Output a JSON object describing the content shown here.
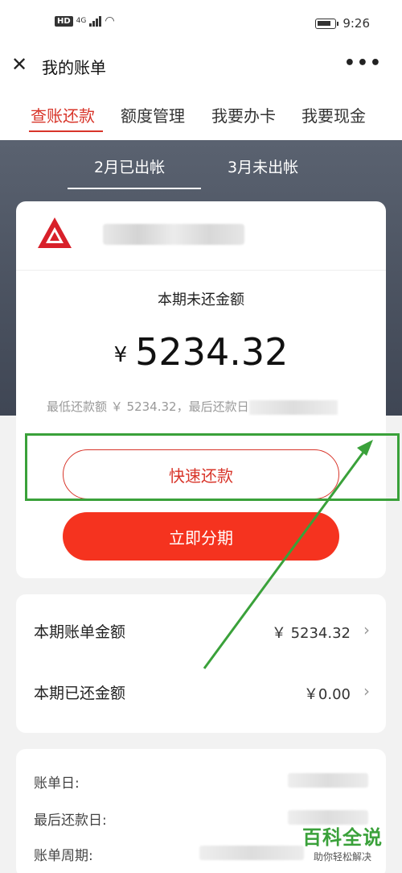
{
  "status_bar": {
    "hd": "HD",
    "network": "4G",
    "time": "9:26"
  },
  "title_bar": {
    "title": "我的账单"
  },
  "tabs": [
    {
      "label": "查账还款",
      "active": true
    },
    {
      "label": "额度管理",
      "active": false
    },
    {
      "label": "我要办卡",
      "active": false
    },
    {
      "label": "我要现金",
      "active": false
    }
  ],
  "month_tabs": [
    {
      "label": "2月已出帐",
      "active": true
    },
    {
      "label": "3月未出帐",
      "active": false
    }
  ],
  "bill": {
    "unpaid_label": "本期未还金额",
    "currency": "¥",
    "unpaid_amount": "5234.32",
    "min_pay_text": "最低还款额 ￥ 5234.32，最后还款日",
    "quick_pay_label": "快速还款",
    "installment_label": "立即分期"
  },
  "summary": [
    {
      "label": "本期账单金额",
      "value": "￥ 5234.32"
    },
    {
      "label": "本期已还金额",
      "value": "￥0.00"
    }
  ],
  "details": [
    {
      "label": "账单日:"
    },
    {
      "label": "最后还款日:"
    },
    {
      "label": "账单周期:"
    }
  ],
  "watermark": {
    "title": "百科全说",
    "subtitle": "助你轻松解决"
  },
  "colors": {
    "accent": "#d8352a",
    "button_red": "#f5331f",
    "highlight_green": "#3aa13a"
  }
}
